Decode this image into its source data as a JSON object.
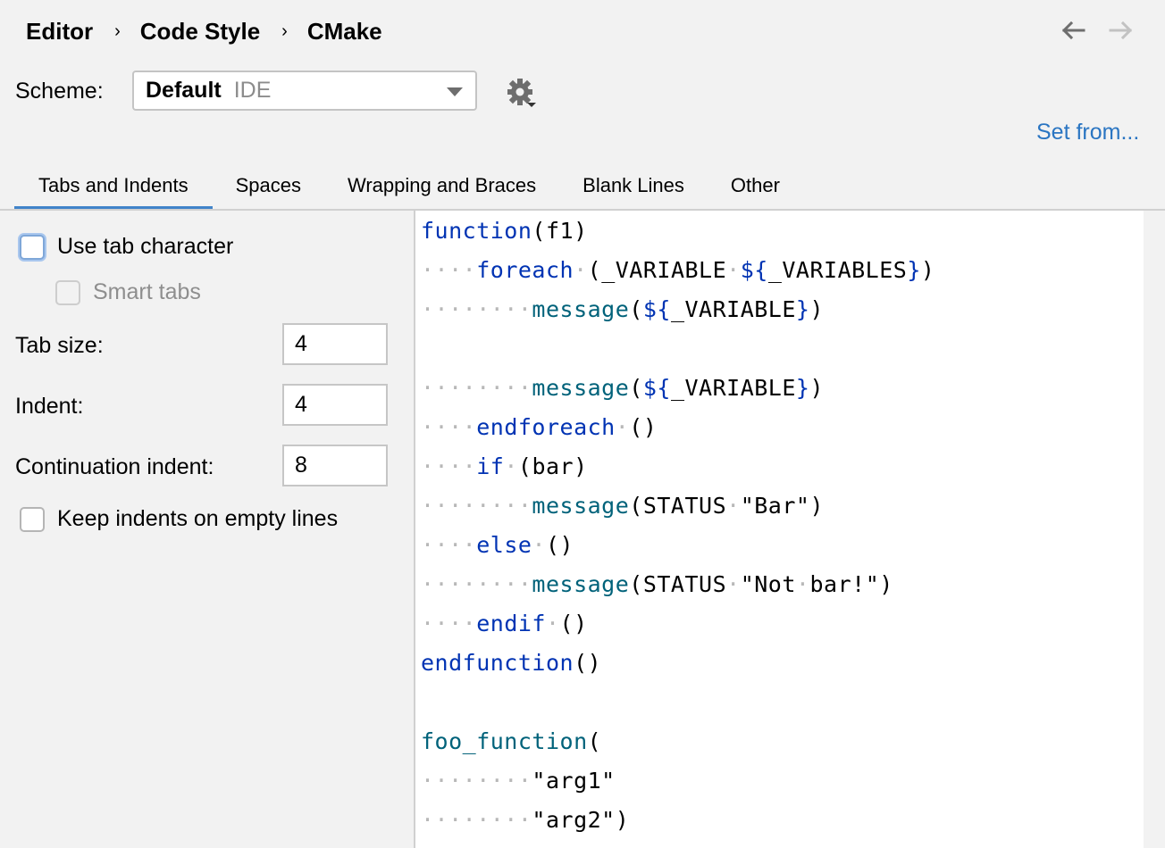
{
  "breadcrumb": {
    "items": [
      "Editor",
      "Code Style",
      "CMake"
    ],
    "separator": "›"
  },
  "navigation": {
    "back_icon": "arrow-left-icon",
    "forward_icon": "arrow-right-icon",
    "back_enabled": true,
    "forward_enabled": false
  },
  "scheme": {
    "label": "Scheme:",
    "selected_name": "Default",
    "selected_type": "IDE",
    "gear_icon": "gear-icon"
  },
  "set_from_label": "Set from...",
  "tabs": [
    {
      "label": "Tabs and Indents",
      "active": true
    },
    {
      "label": "Spaces",
      "active": false
    },
    {
      "label": "Wrapping and Braces",
      "active": false
    },
    {
      "label": "Blank Lines",
      "active": false
    },
    {
      "label": "Other",
      "active": false
    }
  ],
  "options": {
    "use_tab_character": {
      "label": "Use tab character",
      "checked": false
    },
    "smart_tabs": {
      "label": "Smart tabs",
      "checked": false,
      "enabled": false
    },
    "tab_size": {
      "label": "Tab size:",
      "value": "4"
    },
    "indent": {
      "label": "Indent:",
      "value": "4"
    },
    "continuation_indent": {
      "label": "Continuation indent:",
      "value": "8"
    },
    "keep_indents_on_empty_lines": {
      "label": "Keep indents on empty lines",
      "checked": false
    }
  },
  "colors": {
    "accent": "#4083c9",
    "link": "#2a75c2",
    "keyword": "#0033b3",
    "function_call": "#00627a",
    "whitespace_dot": "#b8b8b8"
  },
  "code_preview": {
    "lines": [
      [
        {
          "t": "function",
          "c": "kw"
        },
        {
          "t": "(f1)",
          "c": ""
        }
      ],
      [
        {
          "t": "····",
          "c": "ws"
        },
        {
          "t": "foreach",
          "c": "kw"
        },
        {
          "t": "·",
          "c": "ws"
        },
        {
          "t": "(_VARIABLE",
          "c": ""
        },
        {
          "t": "·",
          "c": "ws"
        },
        {
          "t": "${",
          "c": "br"
        },
        {
          "t": "_VARIABLES",
          "c": ""
        },
        {
          "t": "}",
          "c": "br"
        },
        {
          "t": ")",
          "c": ""
        }
      ],
      [
        {
          "t": "········",
          "c": "ws"
        },
        {
          "t": "message",
          "c": "fn"
        },
        {
          "t": "(",
          "c": ""
        },
        {
          "t": "${",
          "c": "br"
        },
        {
          "t": "_VARIABLE",
          "c": ""
        },
        {
          "t": "}",
          "c": "br"
        },
        {
          "t": ")",
          "c": ""
        }
      ],
      [],
      [
        {
          "t": "········",
          "c": "ws"
        },
        {
          "t": "message",
          "c": "fn"
        },
        {
          "t": "(",
          "c": ""
        },
        {
          "t": "${",
          "c": "br"
        },
        {
          "t": "_VARIABLE",
          "c": ""
        },
        {
          "t": "}",
          "c": "br"
        },
        {
          "t": ")",
          "c": ""
        }
      ],
      [
        {
          "t": "····",
          "c": "ws"
        },
        {
          "t": "endforeach",
          "c": "kw"
        },
        {
          "t": "·",
          "c": "ws"
        },
        {
          "t": "()",
          "c": ""
        }
      ],
      [
        {
          "t": "····",
          "c": "ws"
        },
        {
          "t": "if",
          "c": "kw"
        },
        {
          "t": "·",
          "c": "ws"
        },
        {
          "t": "(bar)",
          "c": ""
        }
      ],
      [
        {
          "t": "········",
          "c": "ws"
        },
        {
          "t": "message",
          "c": "fn"
        },
        {
          "t": "(STATUS",
          "c": ""
        },
        {
          "t": "·",
          "c": "ws"
        },
        {
          "t": "\"Bar\")",
          "c": ""
        }
      ],
      [
        {
          "t": "····",
          "c": "ws"
        },
        {
          "t": "else",
          "c": "kw"
        },
        {
          "t": "·",
          "c": "ws"
        },
        {
          "t": "()",
          "c": ""
        }
      ],
      [
        {
          "t": "········",
          "c": "ws"
        },
        {
          "t": "message",
          "c": "fn"
        },
        {
          "t": "(STATUS",
          "c": ""
        },
        {
          "t": "·",
          "c": "ws"
        },
        {
          "t": "\"Not",
          "c": ""
        },
        {
          "t": "·",
          "c": "ws"
        },
        {
          "t": "bar!\")",
          "c": ""
        }
      ],
      [
        {
          "t": "····",
          "c": "ws"
        },
        {
          "t": "endif",
          "c": "kw"
        },
        {
          "t": "·",
          "c": "ws"
        },
        {
          "t": "()",
          "c": ""
        }
      ],
      [
        {
          "t": "endfunction",
          "c": "kw"
        },
        {
          "t": "()",
          "c": ""
        }
      ],
      [],
      [
        {
          "t": "foo_function",
          "c": "fn"
        },
        {
          "t": "(",
          "c": ""
        }
      ],
      [
        {
          "t": "········",
          "c": "ws"
        },
        {
          "t": "\"arg1\"",
          "c": ""
        }
      ],
      [
        {
          "t": "········",
          "c": "ws"
        },
        {
          "t": "\"arg2\")",
          "c": ""
        }
      ]
    ]
  }
}
